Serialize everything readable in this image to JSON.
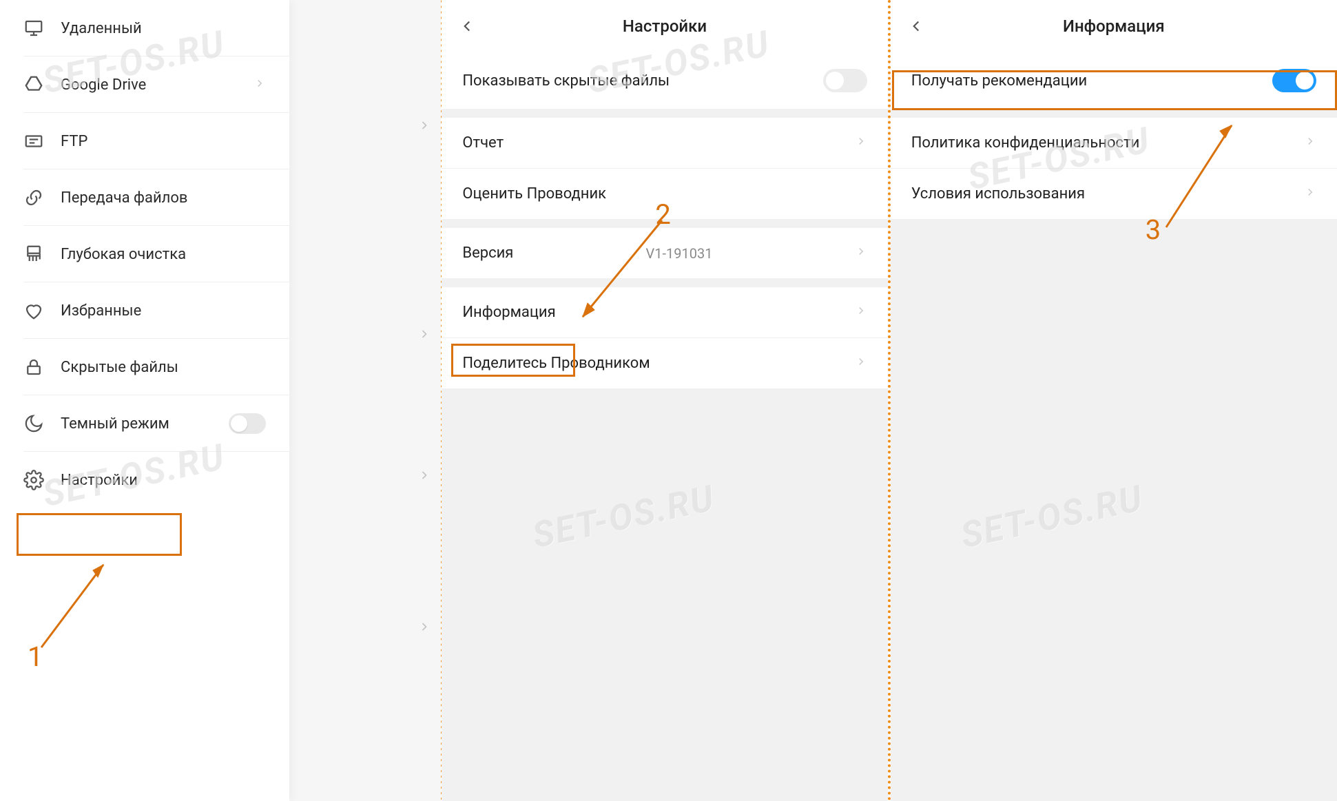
{
  "watermark": "SET-OS.RU",
  "annotations": {
    "step1": "1",
    "step2": "2",
    "step3": "3"
  },
  "panel1": {
    "sidebar_items": [
      {
        "id": "remote",
        "label": "Удаленный"
      },
      {
        "id": "gdrive",
        "label": "Google Drive",
        "chevron": true
      },
      {
        "id": "ftp",
        "label": "FTP"
      },
      {
        "id": "transfer",
        "label": "Передача файлов"
      },
      {
        "id": "deepclean",
        "label": "Глубокая очистка"
      },
      {
        "id": "favorites",
        "label": "Избранные"
      },
      {
        "id": "hidden",
        "label": "Скрытые файлы"
      },
      {
        "id": "darkmode",
        "label": "Темный режим",
        "toggle": true,
        "toggle_on": false
      },
      {
        "id": "settings",
        "label": "Настройки"
      }
    ]
  },
  "panel2": {
    "title": "Настройки",
    "rows": {
      "hidden_files": "Показывать скрытые файлы",
      "report": "Отчет",
      "rate": "Оценить Проводник",
      "version_label": "Версия",
      "version_value": "V1-191031",
      "info": "Информация",
      "share": "Поделитесь Проводником"
    }
  },
  "panel3": {
    "title": "Информация",
    "rows": {
      "recommendations": "Получать рекомендации",
      "privacy": "Политика конфиденциальности",
      "terms": "Условия использования"
    }
  }
}
